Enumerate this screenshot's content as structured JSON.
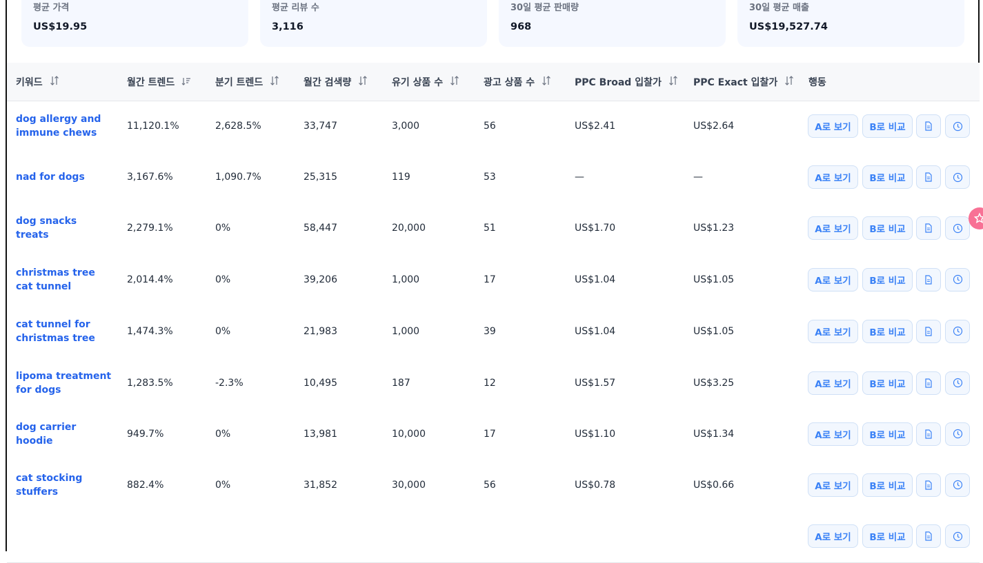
{
  "stats": [
    {
      "label": "평균 가격",
      "value": "US$19.95"
    },
    {
      "label": "평균 리뷰 수",
      "value": "3,116"
    },
    {
      "label": "30일 평균 판매량",
      "value": "968"
    },
    {
      "label": "30일 평균 매출",
      "value": "US$19,527.74"
    }
  ],
  "table": {
    "headers": [
      "키워드",
      "월간 트렌드",
      "분기 트렌드",
      "월간 검색량",
      "유기 상품 수",
      "광고 상품 수",
      "PPC Broad 입찰가",
      "PPC Exact 입찰가",
      "행동"
    ],
    "sort_icons": [
      "sort-both-icon",
      "sort-desc-icon",
      "sort-both-icon",
      "sort-both-icon",
      "sort-both-icon",
      "sort-both-icon",
      "sort-both-icon",
      "sort-both-icon"
    ],
    "actions": {
      "view_a": "A로 보기",
      "compare_b": "B로 비교",
      "icon_doc": "document-icon",
      "icon_history": "clock-icon"
    },
    "rows": [
      {
        "keyword": "dog allergy and immune chews",
        "monthly": "11,120.1%",
        "quarterly": "2,628.5%",
        "search": "33,747",
        "organic": "3,000",
        "ads": "56",
        "broad": "US$2.41",
        "exact": "US$2.64"
      },
      {
        "keyword": "nad for dogs",
        "monthly": "3,167.6%",
        "quarterly": "1,090.7%",
        "search": "25,315",
        "organic": "119",
        "ads": "53",
        "broad": "—",
        "exact": "—"
      },
      {
        "keyword": "dog snacks treats",
        "monthly": "2,279.1%",
        "quarterly": "0%",
        "search": "58,447",
        "organic": "20,000",
        "ads": "51",
        "broad": "US$1.70",
        "exact": "US$1.23"
      },
      {
        "keyword": "christmas tree cat tunnel",
        "monthly": "2,014.4%",
        "quarterly": "0%",
        "search": "39,206",
        "organic": "1,000",
        "ads": "17",
        "broad": "US$1.04",
        "exact": "US$1.05"
      },
      {
        "keyword": "cat tunnel for christmas tree",
        "monthly": "1,474.3%",
        "quarterly": "0%",
        "search": "21,983",
        "organic": "1,000",
        "ads": "39",
        "broad": "US$1.04",
        "exact": "US$1.05"
      },
      {
        "keyword": "lipoma treatment for dogs",
        "monthly": "1,283.5%",
        "quarterly": "-2.3%",
        "search": "10,495",
        "organic": "187",
        "ads": "12",
        "broad": "US$1.57",
        "exact": "US$3.25"
      },
      {
        "keyword": "dog carrier hoodie",
        "monthly": "949.7%",
        "quarterly": "0%",
        "search": "13,981",
        "organic": "10,000",
        "ads": "17",
        "broad": "US$1.10",
        "exact": "US$1.34"
      },
      {
        "keyword": "cat stocking stuffers",
        "monthly": "882.4%",
        "quarterly": "0%",
        "search": "31,852",
        "organic": "30,000",
        "ads": "56",
        "broad": "US$0.78",
        "exact": "US$0.66"
      },
      {
        "keyword": "",
        "monthly": "",
        "quarterly": "",
        "search": "",
        "organic": "",
        "ads": "",
        "broad": "",
        "exact": ""
      }
    ]
  },
  "floating_widget": {
    "icon": "star-badge-icon",
    "color": "#f87195"
  },
  "colors": {
    "accent": "#2563eb",
    "card_bg": "#f5f8ff",
    "button_border": "#cfe0f6"
  }
}
